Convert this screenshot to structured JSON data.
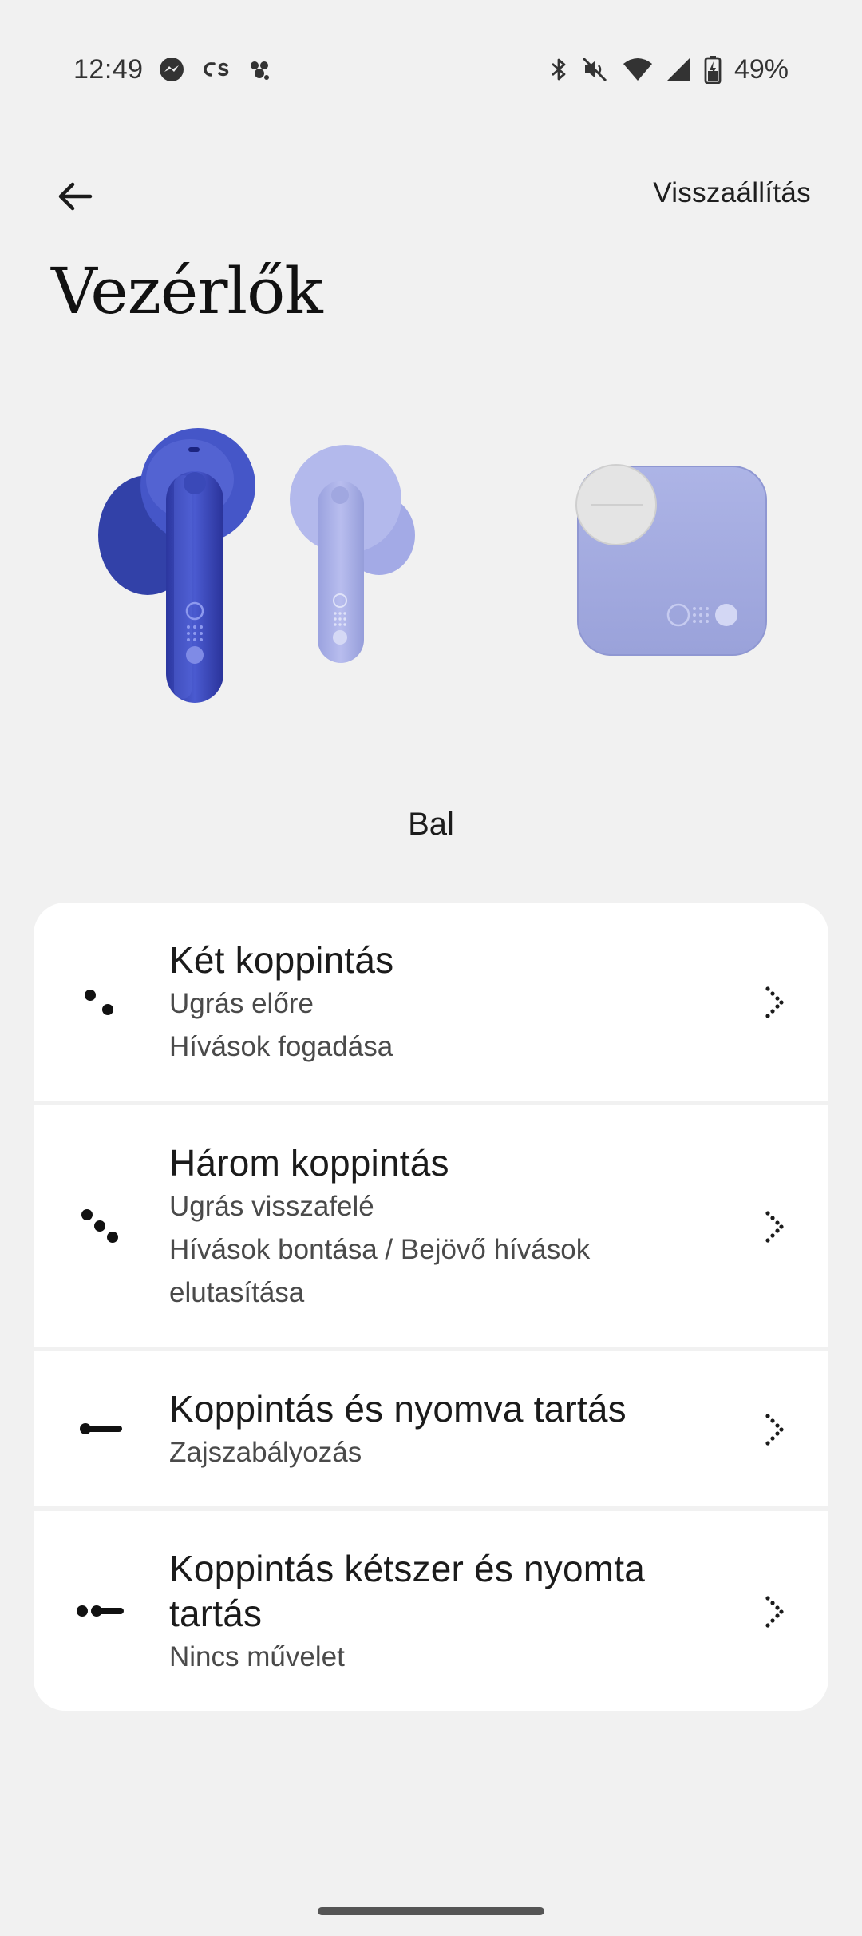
{
  "status_bar": {
    "time": "12:49",
    "battery": "49%",
    "icons_left": [
      "messenger-icon",
      "os-icon",
      "app-icon"
    ],
    "icons_right": [
      "bluetooth-icon",
      "mute-icon",
      "wifi-icon",
      "signal-icon",
      "battery-icon"
    ]
  },
  "header": {
    "back_icon": "arrow-left-icon",
    "reset_label": "Visszaállítás",
    "title": "Vezérlők"
  },
  "illustration": {
    "selected_side_label": "Bal",
    "colors": {
      "left_bud": "#3e4fc0",
      "right_bud": "#a9b0e6",
      "case": "#a6aee0",
      "case_cap": "#e6e6e6"
    }
  },
  "controls": [
    {
      "icon": "double-tap-icon",
      "title": "Két koppintás",
      "subtitles": [
        "Ugrás előre",
        "Hívások fogadása"
      ]
    },
    {
      "icon": "triple-tap-icon",
      "title": "Három koppintás",
      "subtitles": [
        "Ugrás visszafelé",
        "Hívások bontása / Bejövő hívások elutasítása"
      ]
    },
    {
      "icon": "tap-and-hold-icon",
      "title": "Koppintás és nyomva tartás",
      "subtitles": [
        "Zajszabályozás"
      ]
    },
    {
      "icon": "double-tap-and-hold-icon",
      "title": "Koppintás kétszer és nyomta tartás",
      "subtitles": [
        "Nincs művelet"
      ]
    }
  ]
}
